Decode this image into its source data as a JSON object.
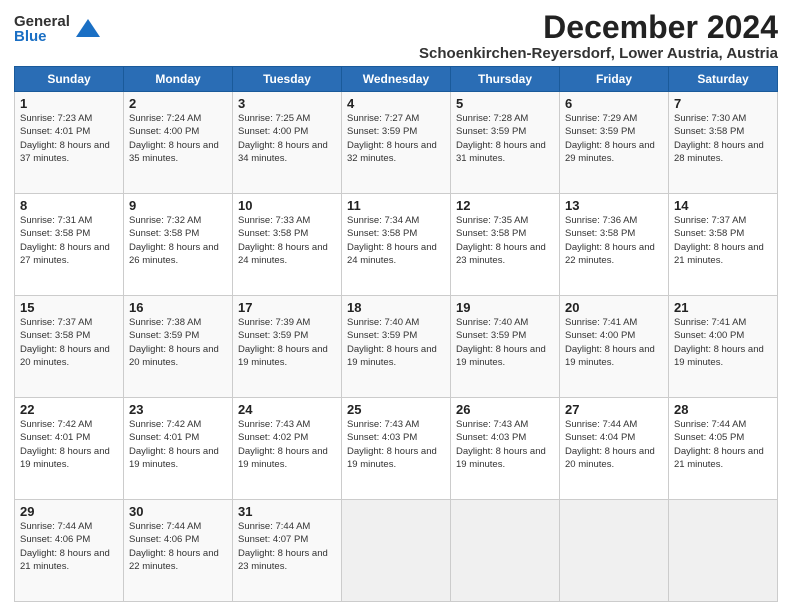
{
  "logo": {
    "general": "General",
    "blue": "Blue"
  },
  "calendar": {
    "title": "December 2024",
    "location": "Schoenkirchen-Reyersdorf, Lower Austria, Austria",
    "days": [
      "Sunday",
      "Monday",
      "Tuesday",
      "Wednesday",
      "Thursday",
      "Friday",
      "Saturday"
    ],
    "weeks": [
      [
        {
          "day": "1",
          "sunrise": "7:23 AM",
          "sunset": "4:01 PM",
          "daylight": "8 hours and 37 minutes."
        },
        {
          "day": "2",
          "sunrise": "7:24 AM",
          "sunset": "4:00 PM",
          "daylight": "8 hours and 35 minutes."
        },
        {
          "day": "3",
          "sunrise": "7:25 AM",
          "sunset": "4:00 PM",
          "daylight": "8 hours and 34 minutes."
        },
        {
          "day": "4",
          "sunrise": "7:27 AM",
          "sunset": "3:59 PM",
          "daylight": "8 hours and 32 minutes."
        },
        {
          "day": "5",
          "sunrise": "7:28 AM",
          "sunset": "3:59 PM",
          "daylight": "8 hours and 31 minutes."
        },
        {
          "day": "6",
          "sunrise": "7:29 AM",
          "sunset": "3:59 PM",
          "daylight": "8 hours and 29 minutes."
        },
        {
          "day": "7",
          "sunrise": "7:30 AM",
          "sunset": "3:58 PM",
          "daylight": "8 hours and 28 minutes."
        }
      ],
      [
        {
          "day": "8",
          "sunrise": "7:31 AM",
          "sunset": "3:58 PM",
          "daylight": "8 hours and 27 minutes."
        },
        {
          "day": "9",
          "sunrise": "7:32 AM",
          "sunset": "3:58 PM",
          "daylight": "8 hours and 26 minutes."
        },
        {
          "day": "10",
          "sunrise": "7:33 AM",
          "sunset": "3:58 PM",
          "daylight": "8 hours and 24 minutes."
        },
        {
          "day": "11",
          "sunrise": "7:34 AM",
          "sunset": "3:58 PM",
          "daylight": "8 hours and 24 minutes."
        },
        {
          "day": "12",
          "sunrise": "7:35 AM",
          "sunset": "3:58 PM",
          "daylight": "8 hours and 23 minutes."
        },
        {
          "day": "13",
          "sunrise": "7:36 AM",
          "sunset": "3:58 PM",
          "daylight": "8 hours and 22 minutes."
        },
        {
          "day": "14",
          "sunrise": "7:37 AM",
          "sunset": "3:58 PM",
          "daylight": "8 hours and 21 minutes."
        }
      ],
      [
        {
          "day": "15",
          "sunrise": "7:37 AM",
          "sunset": "3:58 PM",
          "daylight": "8 hours and 20 minutes."
        },
        {
          "day": "16",
          "sunrise": "7:38 AM",
          "sunset": "3:59 PM",
          "daylight": "8 hours and 20 minutes."
        },
        {
          "day": "17",
          "sunrise": "7:39 AM",
          "sunset": "3:59 PM",
          "daylight": "8 hours and 19 minutes."
        },
        {
          "day": "18",
          "sunrise": "7:40 AM",
          "sunset": "3:59 PM",
          "daylight": "8 hours and 19 minutes."
        },
        {
          "day": "19",
          "sunrise": "7:40 AM",
          "sunset": "3:59 PM",
          "daylight": "8 hours and 19 minutes."
        },
        {
          "day": "20",
          "sunrise": "7:41 AM",
          "sunset": "4:00 PM",
          "daylight": "8 hours and 19 minutes."
        },
        {
          "day": "21",
          "sunrise": "7:41 AM",
          "sunset": "4:00 PM",
          "daylight": "8 hours and 19 minutes."
        }
      ],
      [
        {
          "day": "22",
          "sunrise": "7:42 AM",
          "sunset": "4:01 PM",
          "daylight": "8 hours and 19 minutes."
        },
        {
          "day": "23",
          "sunrise": "7:42 AM",
          "sunset": "4:01 PM",
          "daylight": "8 hours and 19 minutes."
        },
        {
          "day": "24",
          "sunrise": "7:43 AM",
          "sunset": "4:02 PM",
          "daylight": "8 hours and 19 minutes."
        },
        {
          "day": "25",
          "sunrise": "7:43 AM",
          "sunset": "4:03 PM",
          "daylight": "8 hours and 19 minutes."
        },
        {
          "day": "26",
          "sunrise": "7:43 AM",
          "sunset": "4:03 PM",
          "daylight": "8 hours and 19 minutes."
        },
        {
          "day": "27",
          "sunrise": "7:44 AM",
          "sunset": "4:04 PM",
          "daylight": "8 hours and 20 minutes."
        },
        {
          "day": "28",
          "sunrise": "7:44 AM",
          "sunset": "4:05 PM",
          "daylight": "8 hours and 21 minutes."
        }
      ],
      [
        {
          "day": "29",
          "sunrise": "7:44 AM",
          "sunset": "4:06 PM",
          "daylight": "8 hours and 21 minutes."
        },
        {
          "day": "30",
          "sunrise": "7:44 AM",
          "sunset": "4:06 PM",
          "daylight": "8 hours and 22 minutes."
        },
        {
          "day": "31",
          "sunrise": "7:44 AM",
          "sunset": "4:07 PM",
          "daylight": "8 hours and 23 minutes."
        },
        null,
        null,
        null,
        null
      ]
    ]
  }
}
